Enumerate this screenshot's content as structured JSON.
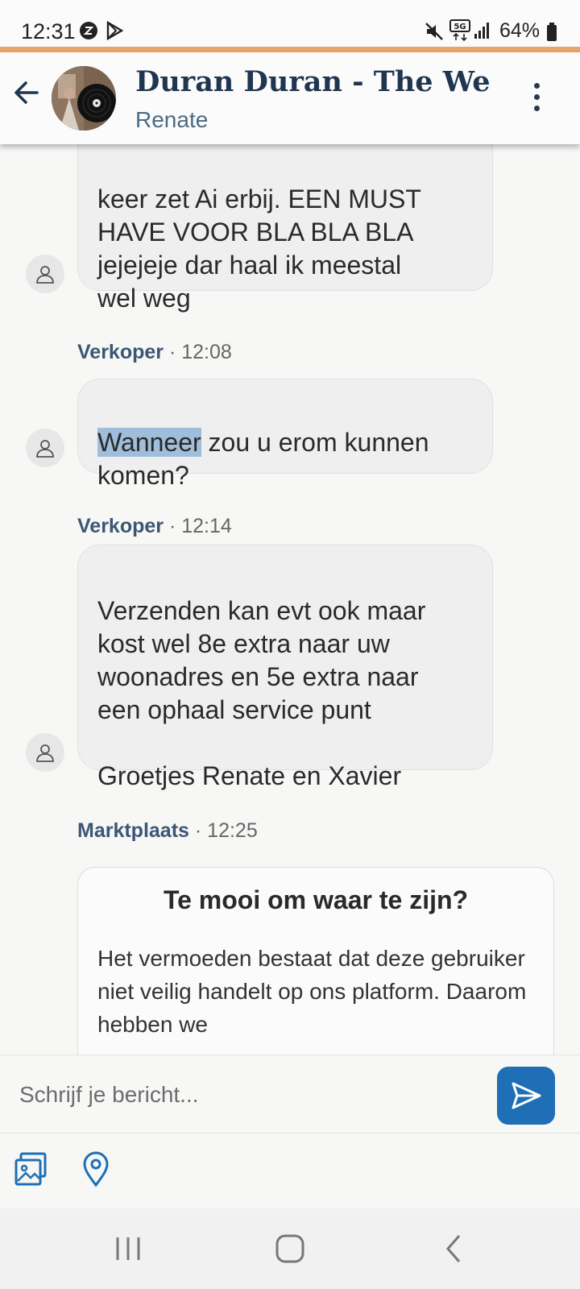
{
  "status_bar": {
    "time": "12:31",
    "battery": "64%",
    "icons": [
      "app-notification-icon",
      "play-store-icon",
      "mute-icon",
      "5g-icon",
      "signal-icon",
      "battery-icon"
    ]
  },
  "header": {
    "title": "Duran Duran - The We...",
    "subtitle": "Renate"
  },
  "messages": [
    {
      "text": "keer zet Ai erbij. EEN MUST\nHAVE VOOR BLA BLA BLA\njejejeje dar haal ik meestal\nwel weg"
    },
    {
      "sender": "Verkoper",
      "time": "· 12:08",
      "text_highlight": "Wanneer",
      "text_rest": " zou u erom kunnen\nkomen?"
    },
    {
      "sender": "Verkoper",
      "time": "· 12:14",
      "text": "Verzenden kan evt ook maar\nkost wel 8e extra naar uw\nwoonadres en 5e extra naar\neen ophaal service punt\n\nGroetjes Renate en Xavier"
    }
  ],
  "notice": {
    "sender": "Marktplaats",
    "time": "· 12:25",
    "title": "Te mooi om waar te zijn?",
    "body": "Het vermoeden bestaat dat deze gebruiker niet veilig handelt op ons platform. Daarom hebben we"
  },
  "composer": {
    "placeholder": "Schrijf je bericht..."
  },
  "colors": {
    "accent_line": "#e8a56a",
    "send_button": "#1e6fb5",
    "title": "#1f3550",
    "sender": "#3b5775",
    "selection": "#9fbedb"
  }
}
